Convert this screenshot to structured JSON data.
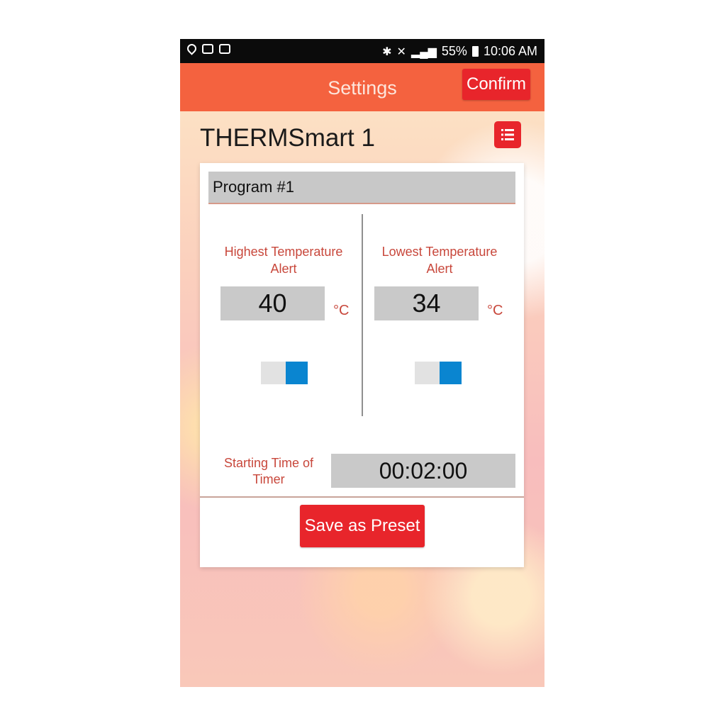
{
  "status_bar": {
    "battery": "55%",
    "time": "10:06 AM",
    "icons": [
      "location-icon",
      "image-icon",
      "mail-icon",
      "bluetooth-icon",
      "mute-icon",
      "signal-icon",
      "battery-icon"
    ]
  },
  "app_bar": {
    "title": "Settings",
    "confirm_label": "Confirm"
  },
  "device": {
    "name": "THERMSmart 1"
  },
  "program": {
    "name": "Program #1"
  },
  "high_alert": {
    "label": "Highest Temperature Alert",
    "value": "40",
    "unit": "°C",
    "enabled": true
  },
  "low_alert": {
    "label": "Lowest Temperature Alert",
    "value": "34",
    "unit": "°C",
    "enabled": true
  },
  "timer": {
    "label": "Starting Time of Timer",
    "value": "00:02:00"
  },
  "actions": {
    "save_preset_label": "Save as Preset"
  },
  "colors": {
    "accent": "#e8252b",
    "app_bar": "#f4623f",
    "toggle_on": "#0a85d0",
    "label_text": "#c8473b"
  }
}
